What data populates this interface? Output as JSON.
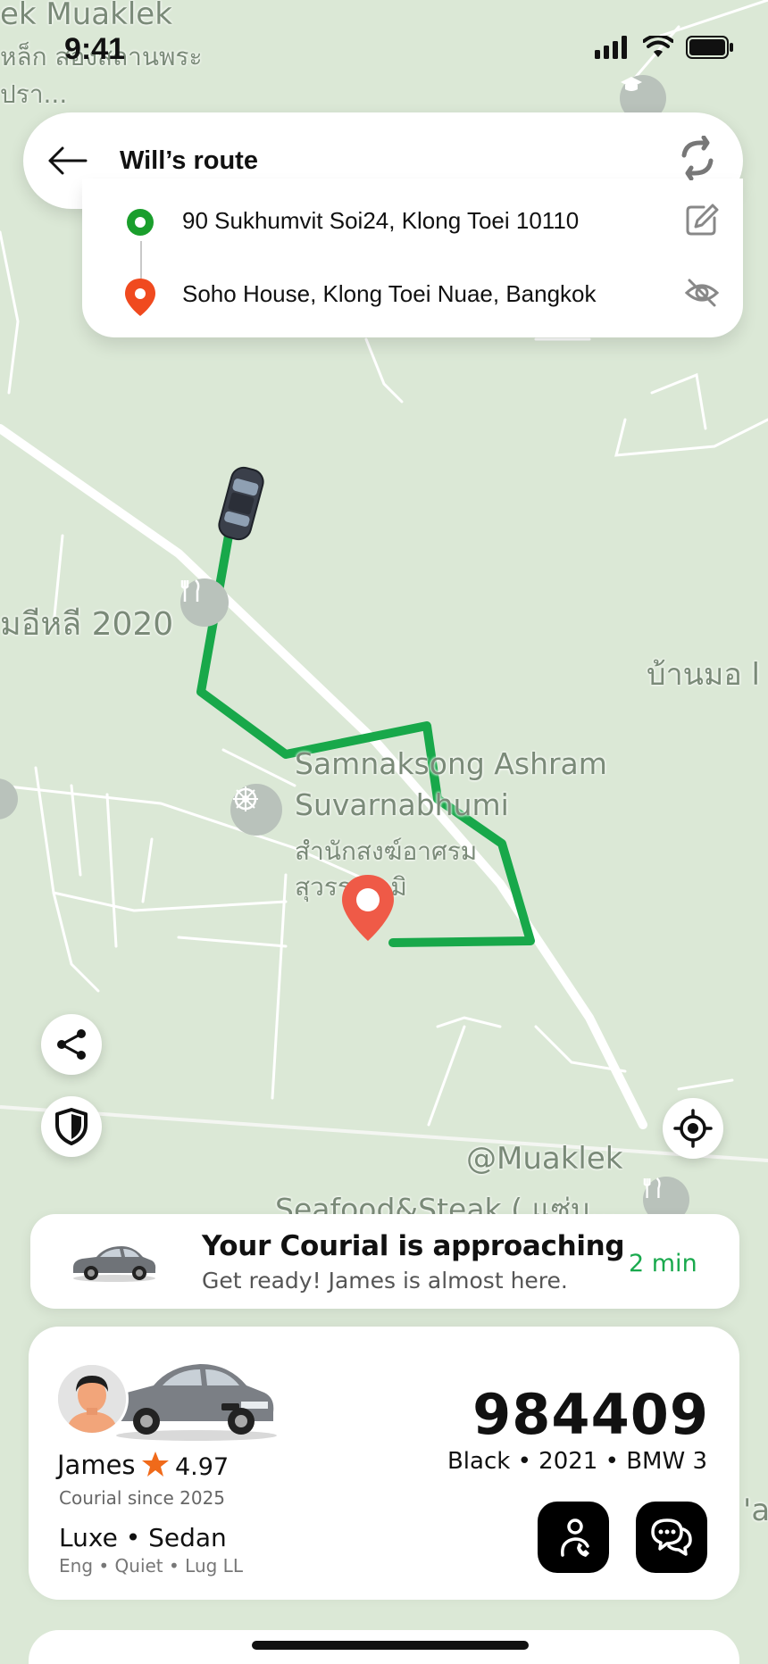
{
  "status_bar": {
    "time": "9:41"
  },
  "route": {
    "title": "Will’s route",
    "pickup": "90 Sukhumvit Soi24, Klong Toei 10110",
    "dropoff": "Soho House, Klong Toei Nuae, Bangkok"
  },
  "map": {
    "labels": {
      "top_left_1": "ek Muaklek",
      "top_left_2": "หล็ก ส่องสถานพระ",
      "top_left_3": "ปรา...",
      "left_mid": "มอีหลี 2020",
      "right_mid": "บ้านมอ l",
      "ashram_en_1": "Samnaksong Ashram",
      "ashram_en_2": "Suvarnabhumi",
      "ashram_th_1": "สำนักสงฆ์อาศรม",
      "ashram_th_2": "สุวรรณภูมิ",
      "muaklek": "@Muaklek",
      "seafood": "Seafood&Steak ( แซ่บ...",
      "right_edge": "'a"
    }
  },
  "approach": {
    "title": "Your Courial is approaching",
    "subtitle": "Get ready! James is almost here.",
    "eta": "2 min"
  },
  "driver": {
    "name": "James",
    "rating": "4.97",
    "since": "Courial since 2025",
    "vehicle_class": "Luxe • Sedan",
    "features": "Eng • Quiet • Lug LL",
    "plate": "984409",
    "vehicle": "Black • 2021 • BMW 3"
  },
  "colors": {
    "route": "#18a84a",
    "pickup": "#1a9e2c",
    "dropoff": "#f04a1f",
    "eta": "#19a94d",
    "star": "#f06a1a"
  }
}
